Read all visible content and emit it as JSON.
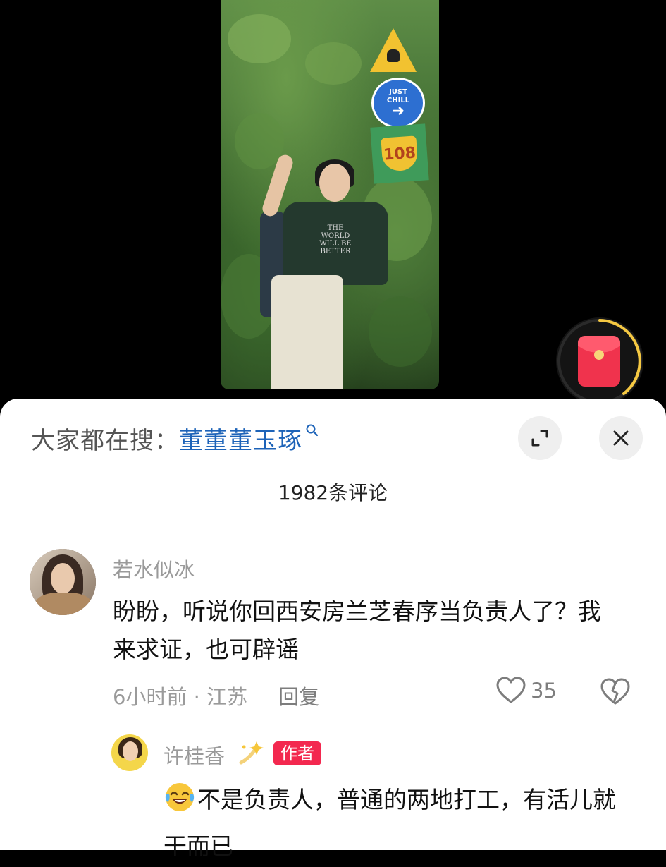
{
  "video": {
    "shirt_text": "THE WORLD WILL BE BETTER",
    "sign_blue_text": "JUST CHILL",
    "sign_shield_text": "108"
  },
  "search": {
    "prefix": "大家都在搜：",
    "term": "董董董玉琢"
  },
  "comments": {
    "count_label": "1982条评论",
    "items": [
      {
        "username": "若水似冰",
        "text": "盼盼，听说你回西安房兰芝春序当负责人了？我来求证，也可辟谣",
        "time_location": "6小时前 · 江苏",
        "reply_label": "回复",
        "likes": "35",
        "replies": [
          {
            "username": "许桂香",
            "badge": "作者",
            "emoji": "laughing-crying-icon",
            "text": "不是负责人，普通的两地打工，有活儿就干而已"
          }
        ]
      }
    ]
  },
  "colors": {
    "accent_link": "#1d63b8",
    "author_badge": "#f3284f",
    "red_packet": "#f0334d",
    "ring": "#f5c842"
  },
  "icons": [
    "search-icon",
    "expand-icon",
    "close-icon",
    "heart-icon",
    "dislike-icon",
    "sparkle-icon",
    "red-packet-icon"
  ]
}
